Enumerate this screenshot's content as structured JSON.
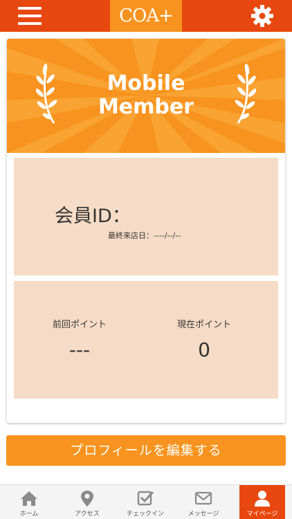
{
  "header": {
    "logo": "COA+",
    "menu_icon": "hamburger-menu-icon",
    "settings_icon": "gear-icon"
  },
  "colors": {
    "header_red": "#e8480f",
    "brand_orange": "#f7931e",
    "panel_beige": "#f6dcc6"
  },
  "banner": {
    "title_line1": "Mobile",
    "title_line2": "Member",
    "decoration_icon": "laurel-icon"
  },
  "member": {
    "id_label": "会員ID：",
    "last_visit": "最終来店日：----/--/--"
  },
  "points": {
    "previous_label": "前回ポイント",
    "previous_value": "---",
    "current_label": "現在ポイント",
    "current_value": "0"
  },
  "actions": {
    "edit_profile": "プロフィールを編集する"
  },
  "tabbar": {
    "items": [
      {
        "label": "ホーム",
        "icon": "home-icon"
      },
      {
        "label": "アクセス",
        "icon": "map-pin-icon"
      },
      {
        "label": "チェックイン",
        "icon": "checkin-icon"
      },
      {
        "label": "メッセージ",
        "icon": "envelope-icon"
      },
      {
        "label": "マイページ",
        "icon": "user-icon",
        "active": true
      }
    ]
  }
}
